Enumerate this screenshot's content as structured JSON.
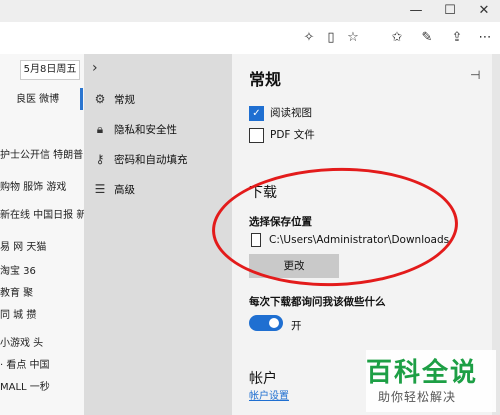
{
  "window": {
    "minimize": "—",
    "maximize": "☐",
    "close": "✕",
    "page_date": "5月8日周五"
  },
  "background_page": {
    "rows": [
      "良医  微博",
      "护士公开信  特朗普",
      "购物  服饰  游戏",
      "新在线  中国日报  新",
      "易 网    天猫",
      "淘宝        36",
      "教育        聚",
      "同 城       攒",
      "小游戏      头",
      "· 看点      中国",
      "MALL     一秒"
    ]
  },
  "nav": {
    "items": [
      {
        "icon": "gear-icon",
        "label": "常规"
      },
      {
        "icon": "lock-icon",
        "label": "隐私和安全性"
      },
      {
        "icon": "key-icon",
        "label": "密码和自动填充"
      },
      {
        "icon": "sliders-icon",
        "label": "高级"
      }
    ]
  },
  "panel": {
    "title": "常规",
    "reading_view_label": "阅读视图",
    "pdf_label": "PDF 文件",
    "downloads_heading": "下载",
    "save_location_label": "选择保存位置",
    "save_path": "C:\\Users\\Administrator\\Downloads",
    "change_button": "更改",
    "ask_label": "每次下载都询问我该做些什么",
    "toggle_state": "开",
    "account_heading": "帐户",
    "account_link": "帐户设置"
  },
  "watermark": {
    "logo": "百科全说",
    "sub": "助你轻松解决"
  }
}
